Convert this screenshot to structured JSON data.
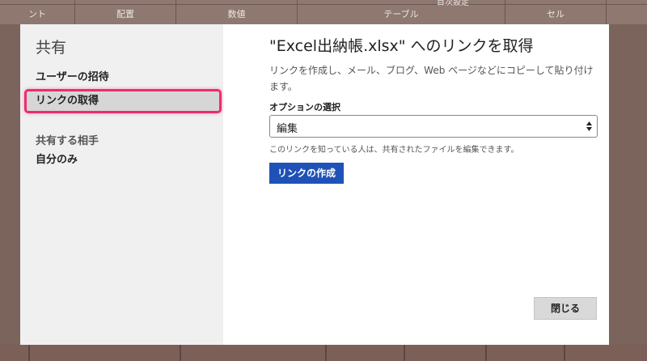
{
  "ribbon": {
    "top_text": "目次設定",
    "groups": [
      "ント",
      "配置",
      "数値",
      "テーブル",
      "セル"
    ]
  },
  "sidebar": {
    "title": "共有",
    "items": [
      {
        "label": "ユーザーの招待",
        "selected": false
      },
      {
        "label": "リンクの取得",
        "selected": true
      }
    ],
    "section_label": "共有する相手",
    "section_value": "自分のみ"
  },
  "main": {
    "title": "\"Excel出納帳.xlsx\" へのリンクを取得",
    "description": "リンクを作成し、メール、ブログ、Web ページなどにコピーして貼り付けます。",
    "option_label": "オプションの選択",
    "option_value": "編集",
    "hint": "このリンクを知っている人は、共有されたファイルを編集できます。",
    "create_button": "リンクの作成",
    "close_button": "閉じる"
  },
  "colors": {
    "accent_button": "#1f52b8",
    "highlight": "#ec2d6b",
    "sidebar_bg": "#f0f0f0"
  }
}
